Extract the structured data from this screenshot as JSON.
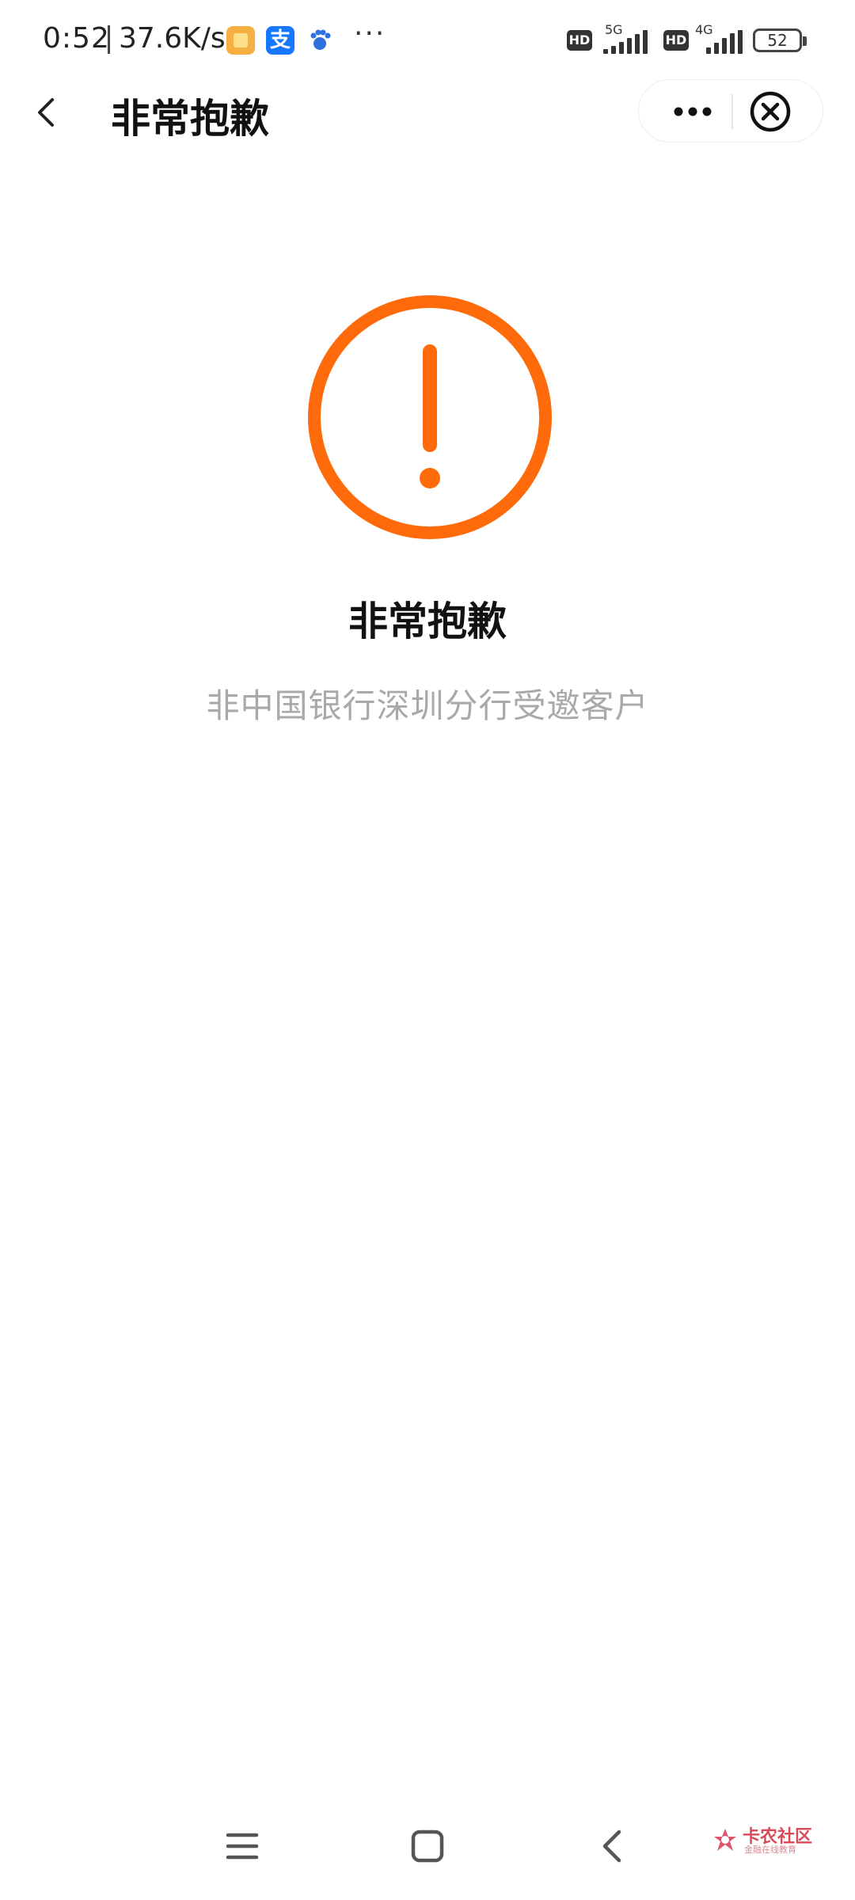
{
  "status_bar": {
    "time": "0:52",
    "net_speed": "37.6K/s",
    "notification_icons": [
      "gallery-icon",
      "alipay-icon",
      "baidu-icon"
    ],
    "alipay_glyph": "支",
    "more": "···",
    "hd_label": "HD",
    "sim1_network": "5G",
    "sim2_network": "4G",
    "battery_level": "52"
  },
  "nav": {
    "title": "非常抱歉",
    "back_icon": "chevron-left-icon",
    "more_icon": "more-dots-icon",
    "close_icon": "close-circle-icon"
  },
  "result": {
    "icon": "warning-circle-icon",
    "icon_color": "#ff6a0a",
    "title": "非常抱歉",
    "description": "非中国银行深圳分行受邀客户"
  },
  "system_nav": {
    "menu_icon": "menu-icon",
    "home_icon": "home-square-icon",
    "back_icon": "back-chevron-icon"
  },
  "watermark": {
    "text": "卡农社区",
    "subtext": "金融在线教育"
  }
}
